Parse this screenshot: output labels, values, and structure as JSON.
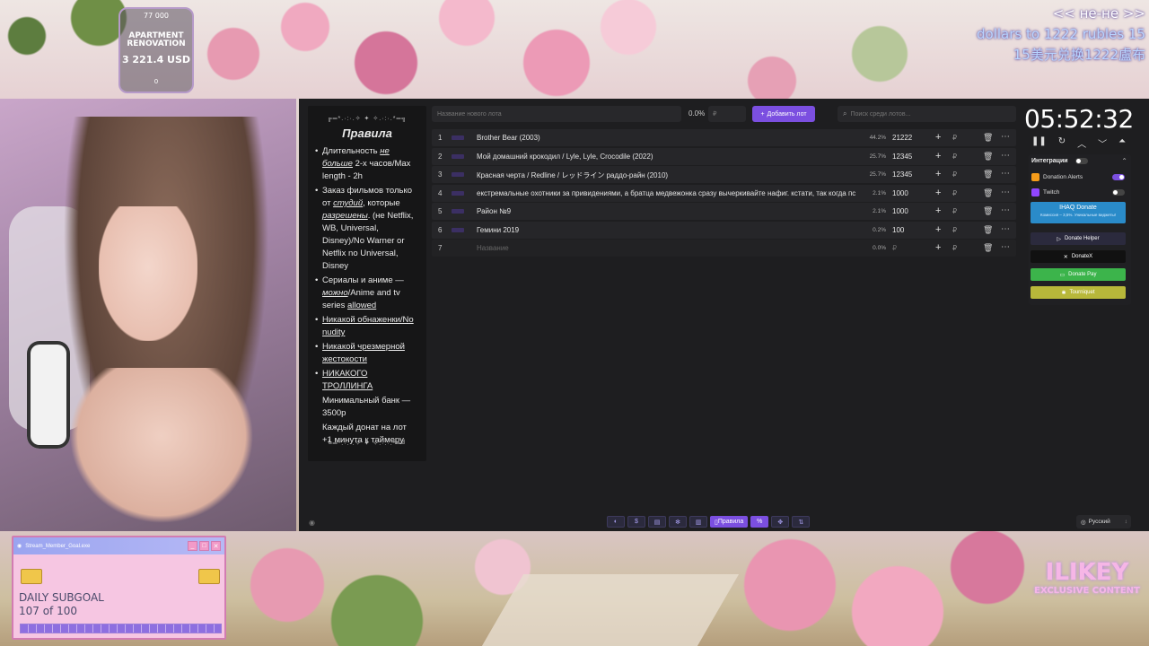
{
  "goal": {
    "top": "77 000",
    "title": "APARTMENT RENOVATION",
    "amount": "3 221.4 USD",
    "bottom": "0"
  },
  "overlay_topright": {
    "line1": "<< не-не >>",
    "line2": "dollars to 1222 rubles 15",
    "line3": "15美元兑换1222盧布"
  },
  "rules": {
    "ornament_top": "╔═*.·:·.✧ ✦ ✧.·:·.*═╗",
    "title": "Правила",
    "items": [
      {
        "pre": "Длительность ",
        "em": "не больше",
        "post": " 2-х часов/Max length - 2h"
      },
      {
        "pre": "Заказ фильмов только от ",
        "em": "студий",
        "mid": ", которые ",
        "em2": "разрешены",
        "post": ". (не Netflix, WB, Universal, Disney)/No Warner or Netflix no Universal, Disney"
      },
      {
        "pre": "Сериалы и аниме — ",
        "em": "можно",
        "post": "/Anime and tv series ",
        "ul": "allowed"
      },
      {
        "ul": "Никакой обнаженки/No nudity"
      },
      {
        "ul": "Никакой чрезмерной жестокости"
      },
      {
        "ul": "НИКАКОГО ТРОЛЛИНГА"
      },
      {
        "pre": "Минимальный банк — 3500р"
      },
      {
        "pre": "Каждый донат на лот +1 минута к таймеру"
      }
    ],
    "ornament_bottom": "╚═*.·:·.✧ ✦ ✧.·:·.*═╝"
  },
  "toolbar": {
    "new_lot_placeholder": "Название нового лота",
    "percent": "0.0%",
    "price_placeholder": "₽",
    "add_button": "Добавить лот",
    "search_placeholder": "Поиск среди лотов..."
  },
  "lots": [
    {
      "num": "1",
      "name": "Brother Bear (2003)",
      "pct": "44.2%",
      "amount": "21222"
    },
    {
      "num": "2",
      "name": "Мой домашний крокодил / Lyle, Lyle, Crocodile (2022)",
      "pct": "25.7%",
      "amount": "12345"
    },
    {
      "num": "3",
      "name": "Красная черта / Redline / レッドライン раддо-райн (2010)",
      "pct": "25.7%",
      "amount": "12345"
    },
    {
      "num": "4",
      "name": "екстремальные охотники за привидениями, а братца медвежонка сразу вычеркивайте нафиг. кстати, так когда пс",
      "pct": "2.1%",
      "amount": "1000"
    },
    {
      "num": "5",
      "name": "Район №9",
      "pct": "2.1%",
      "amount": "1000"
    },
    {
      "num": "6",
      "name": "Гемини 2019",
      "pct": "0.2%",
      "amount": "100"
    },
    {
      "num": "7",
      "name": "Название",
      "pct": "0.0%",
      "amount": "₽"
    }
  ],
  "rub_symbol": "₽",
  "timer": {
    "value": "05:52:32"
  },
  "integrations": {
    "header": "Интеграции",
    "donation_alerts": "Donation Alerts",
    "twitch": "Twitch",
    "ihaq_title": "IHAQ Donate",
    "ihaq_sub": "Комиссия – 3,5%. Уникальные виджеты!",
    "donate_helper": "Donate Helper",
    "donatex": "DonateX",
    "donate_pay": "Donate Pay",
    "tourniquet": "Tourniquet"
  },
  "bottom_bar": {
    "rules_tab": "Правила",
    "language": "Русский"
  },
  "subgoal": {
    "window_title": "Stream_Member_Goal.exe",
    "label": "DAILY SUBGOAL",
    "count": "107 of 100",
    "progress": 1.0
  },
  "watermark": {
    "line1": "ILIKEY",
    "line2": "EXCLUSIVE CONTENT"
  },
  "colors": {
    "accent": "#7b4fe0",
    "ihaq": "#2a8bc9",
    "donate_pay": "#3cb44b",
    "tourniquet": "#b8b83a"
  }
}
